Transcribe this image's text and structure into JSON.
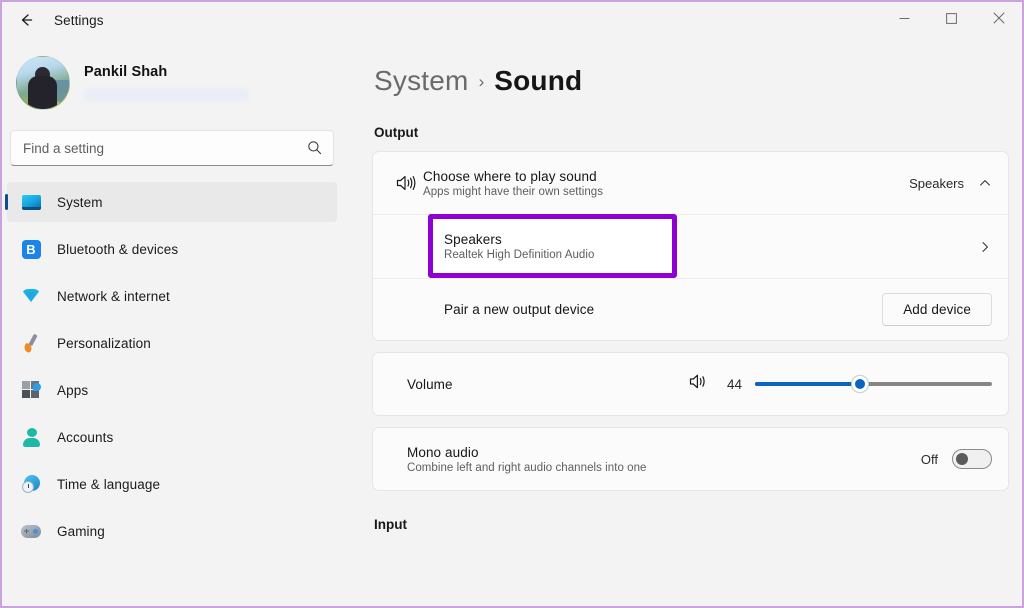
{
  "window": {
    "app_title": "Settings",
    "back_icon": "back-arrow-icon",
    "minimize_label": "—",
    "maximize_label": "☐",
    "close_label": "✕"
  },
  "sidebar": {
    "account": {
      "name": "Pankil Shah",
      "avatar_alt": "user-avatar",
      "email_redacted": ""
    },
    "search": {
      "placeholder": "Find a setting",
      "value": "",
      "icon": "search-icon"
    },
    "items": [
      {
        "label": "System",
        "icon": "system-icon",
        "selected": true
      },
      {
        "label": "Bluetooth & devices",
        "icon": "bluetooth-icon",
        "selected": false
      },
      {
        "label": "Network & internet",
        "icon": "wifi-icon",
        "selected": false
      },
      {
        "label": "Personalization",
        "icon": "paintbrush-icon",
        "selected": false
      },
      {
        "label": "Apps",
        "icon": "apps-icon",
        "selected": false
      },
      {
        "label": "Accounts",
        "icon": "account-icon",
        "selected": false
      },
      {
        "label": "Time & language",
        "icon": "clock-globe-icon",
        "selected": false
      },
      {
        "label": "Gaming",
        "icon": "gamepad-icon",
        "selected": false
      }
    ]
  },
  "main": {
    "breadcrumb": {
      "parent": "System",
      "separator": "›",
      "current": "Sound"
    },
    "output_section": {
      "title": "Output",
      "choose_device": {
        "icon": "speaker-volume-icon",
        "title": "Choose where to play sound",
        "subtitle": "Apps might have their own settings",
        "value": "Speakers",
        "expand_icon": "chevron-up-icon"
      },
      "selected_device": {
        "title": "Speakers",
        "subtitle": "Realtek High Definition Audio",
        "chevron_icon": "chevron-right-icon",
        "highlight_color": "#8f00d3"
      },
      "pair_device": {
        "title": "Pair a new output device",
        "button_label": "Add device"
      }
    },
    "volume_section": {
      "title": "Volume",
      "icon": "speaker-volume-icon",
      "value": "44",
      "min": 0,
      "max": 100,
      "fill_color": "#0a64c2",
      "track_color": "#868686"
    },
    "mono_section": {
      "title": "Mono audio",
      "subtitle": "Combine left and right audio channels into one",
      "state_label": "Off",
      "state_on": false
    },
    "input_section": {
      "title": "Input"
    }
  },
  "theme": {
    "accent": "#0a64c2",
    "highlight": "#8f00d3",
    "window_border": "#c9a3dd",
    "page_bg": "#f3f3f3",
    "card_bg": "#fbfbfb"
  }
}
